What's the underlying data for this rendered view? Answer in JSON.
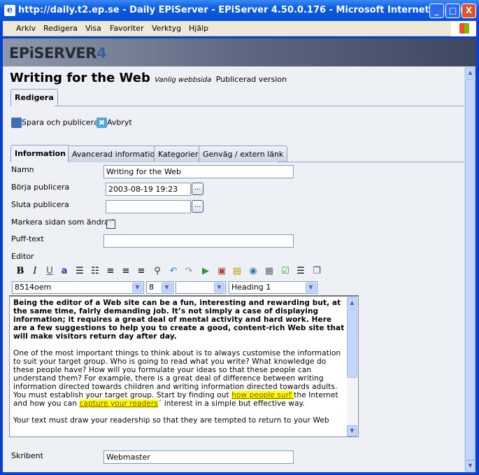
{
  "window": {
    "title": "http://daily.t2.ep.se - Daily EPiServer - EPiServer 4.50.0.176 - Microsoft Internet Explorer",
    "minimize": "_",
    "maximize": "□",
    "close": "X"
  },
  "menu": [
    "Arkiv",
    "Redigera",
    "Visa",
    "Favoriter",
    "Verktyg",
    "Hjälp"
  ],
  "brand": {
    "name": "EPiSERVER",
    "version": "4"
  },
  "page": {
    "title": "Writing for the Web",
    "type": "Vanlig webbsida",
    "status": "Publicerad version"
  },
  "main_tab": "Redigera",
  "actions": {
    "save": "Spara och publicera",
    "cancel": "Avbryt"
  },
  "tabs": [
    "Information",
    "Avancerad information",
    "Kategorier",
    "Genväg / extern länk"
  ],
  "fields": {
    "name": {
      "label": "Namn",
      "value": "Writing for the Web"
    },
    "start": {
      "label": "Börja publicera",
      "value": "2003-08-19 19:23",
      "button": "..."
    },
    "stop": {
      "label": "Sluta publicera",
      "value": "",
      "button": "..."
    },
    "changed": {
      "label": "Markera sidan som ändrad",
      "checked": false
    },
    "puff": {
      "label": "Puff-text",
      "value": ""
    },
    "editor_label": "Editor",
    "author": {
      "label": "Skribent",
      "value": "Webmaster"
    }
  },
  "editor": {
    "toolbar_icons": [
      "bold-icon",
      "italic-icon",
      "underline-icon",
      "font-color-icon",
      "numbered-list-icon",
      "bullet-list-icon",
      "align-left-icon",
      "align-center-icon",
      "align-right-icon",
      "find-icon",
      "undo-icon",
      "redo-icon",
      "insert-link-icon",
      "insert-image-icon",
      "insert-document-icon",
      "web-link-icon",
      "table-icon",
      "spellcheck-icon",
      "format-icon",
      "window-icon"
    ],
    "font": "8514oem",
    "size": "8",
    "color": "",
    "style": "Heading 1",
    "intro": "Being the editor of a Web site can be a fun, interesting and rewarding but, at the same time, fairly demanding job. It’s not simply a case of displaying information; it requires a great deal of mental activity and hard work. Here are a few suggestions to help you to create a good, content-rich Web site that will make visitors return day after day.",
    "p2_a": "One of the most important things to think about is to always customise the information to suit your target group. Who is going to read what you write? What knowledge do these people have? How will you formulate your ideas so that these people can understand them? For example, there is a great deal of difference between writing information directed towards children and writing information directed towards adults. You must establish your target group. Start by finding out ",
    "link1": "how people surf ",
    "p2_b": "the Internet and how you can ",
    "link2": "capture your readers",
    "p2_c": "´ interest in a simple but effective way.",
    "p3": "Your text must draw your readership so that they are tempted to return to your Web"
  },
  "colors": {
    "highlight": "#ffff00",
    "titlebar": "#0a5ae0",
    "content_bg": "#edf0f5"
  }
}
